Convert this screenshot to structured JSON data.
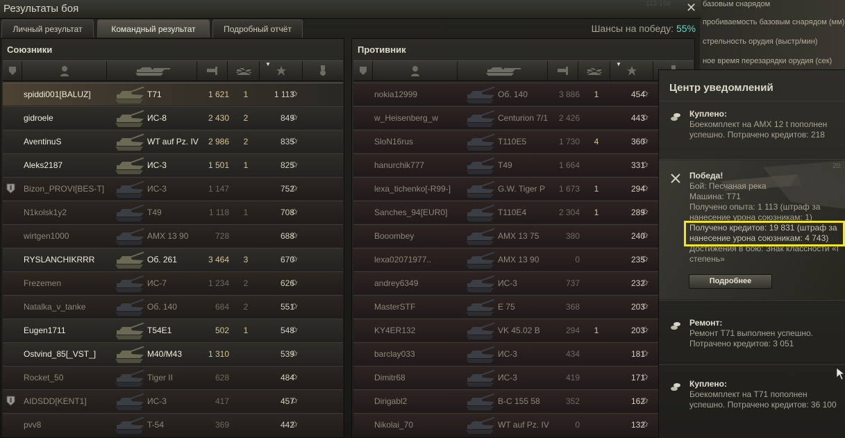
{
  "window": {
    "title": "Результаты боя",
    "ghost_text": "113-168"
  },
  "background_tooltip": {
    "lines": [
      "базовым снарядом",
      "пробиваемость базовым снарядом (мм)",
      "стрельность орудия (выстр/мин)",
      "ное время перезарядки орудия (сек)"
    ]
  },
  "tabs": [
    {
      "label": "Личный результат",
      "active": false
    },
    {
      "label": "Командный результат",
      "active": true
    },
    {
      "label": "Подробный отчёт",
      "active": false
    }
  ],
  "win_chance": {
    "label": "Шансы на победу:",
    "value": "55%"
  },
  "teams": {
    "allies": {
      "name": "Союзники",
      "players": [
        {
          "name": "spiddi001[BALUZ]",
          "vehicle": "T71",
          "damage": "1 621",
          "kills": "1",
          "xp": "1 113",
          "state": "self",
          "clan_icon": false
        },
        {
          "name": "gidroele",
          "vehicle": "ИС-8",
          "damage": "2 430",
          "kills": "2",
          "xp": "849",
          "state": "alive",
          "clan_icon": false
        },
        {
          "name": "AventinuS",
          "vehicle": "WT auf Pz. IV",
          "damage": "2 986",
          "kills": "2",
          "xp": "835",
          "state": "alive",
          "clan_icon": false
        },
        {
          "name": "Aleks2187",
          "vehicle": "ИС-3",
          "damage": "1 501",
          "kills": "1",
          "xp": "825",
          "state": "alive",
          "clan_icon": false
        },
        {
          "name": "Bizon_PROVI[BES-T]",
          "vehicle": "ИС-3",
          "damage": "1 147",
          "kills": "",
          "xp": "752",
          "state": "dead",
          "clan_icon": true
        },
        {
          "name": "N1kolsk1y2",
          "vehicle": "T49",
          "damage": "1 118",
          "kills": "1",
          "xp": "708",
          "state": "dead",
          "clan_icon": false
        },
        {
          "name": "wirtgen1000",
          "vehicle": "AMX 13 90",
          "damage": "728",
          "kills": "",
          "xp": "688",
          "state": "dead",
          "clan_icon": false
        },
        {
          "name": "RYSLANCHIKRRR",
          "vehicle": "Об. 261",
          "damage": "3 464",
          "kills": "3",
          "xp": "670",
          "state": "alive",
          "clan_icon": false
        },
        {
          "name": "Frezemen",
          "vehicle": "ИС-7",
          "damage": "1 234",
          "kills": "2",
          "xp": "626",
          "state": "dead",
          "clan_icon": false
        },
        {
          "name": "Natalka_v_tanke",
          "vehicle": "Об. 140",
          "damage": "684",
          "kills": "2",
          "xp": "551",
          "state": "dead",
          "clan_icon": false
        },
        {
          "name": "Eugen1711",
          "vehicle": "T54E1",
          "damage": "502",
          "kills": "1",
          "xp": "548",
          "state": "alive",
          "clan_icon": false
        },
        {
          "name": "Ostvind_85[_VST_]",
          "vehicle": "M40/M43",
          "damage": "1 310",
          "kills": "",
          "xp": "539",
          "state": "alive",
          "clan_icon": false
        },
        {
          "name": "Rocket_50",
          "vehicle": "Tiger II",
          "damage": "628",
          "kills": "",
          "xp": "484",
          "state": "dead",
          "clan_icon": false
        },
        {
          "name": "AIDSDD[KENT1]",
          "vehicle": "ИС-3",
          "damage": "417",
          "kills": "",
          "xp": "457",
          "state": "dead",
          "clan_icon": true
        },
        {
          "name": "pvv8",
          "vehicle": "T-54",
          "damage": "369",
          "kills": "",
          "xp": "442",
          "state": "dead",
          "clan_icon": false
        }
      ]
    },
    "enemies": {
      "name": "Противник",
      "players": [
        {
          "name": "nokia12999",
          "vehicle": "Об. 140",
          "damage": "3 886",
          "kills": "1",
          "xp": "454",
          "state": "dead"
        },
        {
          "name": "w_Heisenberg_w",
          "vehicle": "Centurion 7/1",
          "damage": "2 426",
          "kills": "",
          "xp": "443",
          "state": "dead"
        },
        {
          "name": "SloN16rus",
          "vehicle": "T110E5",
          "damage": "1 730",
          "kills": "4",
          "xp": "360",
          "state": "dead"
        },
        {
          "name": "hanurchik777",
          "vehicle": "T49",
          "damage": "1 664",
          "kills": "",
          "xp": "331",
          "state": "dead"
        },
        {
          "name": "lexa_tichenko[-R99-]",
          "vehicle": "G.W. Tiger P",
          "damage": "1 673",
          "kills": "1",
          "xp": "294",
          "state": "dead"
        },
        {
          "name": "Sanches_94[EUR0]",
          "vehicle": "T110E4",
          "damage": "2 304",
          "kills": "1",
          "xp": "289",
          "state": "dead"
        },
        {
          "name": "Booombey",
          "vehicle": "AMX 13 75",
          "damage": "380",
          "kills": "",
          "xp": "240",
          "state": "dead"
        },
        {
          "name": "lexa02071977..",
          "vehicle": "AMX 13 90",
          "damage": "0",
          "kills": "",
          "xp": "235",
          "state": "dead"
        },
        {
          "name": "andrey6349",
          "vehicle": "ИС-3",
          "damage": "737",
          "kills": "",
          "xp": "232",
          "state": "dead"
        },
        {
          "name": "MasterSTF",
          "vehicle": "E 75",
          "damage": "368",
          "kills": "",
          "xp": "203",
          "state": "dead"
        },
        {
          "name": "KY4ER132",
          "vehicle": "VK 45.02 B",
          "damage": "294",
          "kills": "1",
          "xp": "203",
          "state": "dead"
        },
        {
          "name": "barclay033",
          "vehicle": "ИС-3",
          "damage": "434",
          "kills": "",
          "xp": "181",
          "state": "dead"
        },
        {
          "name": "Dimitr68",
          "vehicle": "ИС-3",
          "damage": "419",
          "kills": "",
          "xp": "171",
          "state": "dead"
        },
        {
          "name": "Dirigabl2",
          "vehicle": "B-C 155 58",
          "damage": "352",
          "kills": "",
          "xp": "162",
          "state": "dead"
        },
        {
          "name": "Nikolai_70",
          "vehicle": "WT auf Pz. IV",
          "damage": "0",
          "kills": "",
          "xp": "132",
          "state": "dead"
        }
      ]
    }
  },
  "notifications": {
    "title": "Центр уведомлений",
    "items": [
      {
        "heading": "Куплено:",
        "lines": [
          "Боекомплект на AMX 12 t пополнен",
          "успешно. Потрачено кредитов:  218"
        ],
        "icon": "coins-icon"
      },
      {
        "heading": "Победа!",
        "time": "20:",
        "lines": [
          "Бой: Песчаная река",
          "Машина: T71",
          "Получено опыта: 1 113 (штраф за",
          "нанесение урона союзникам: 1)",
          "Получено кредитов: 19 831 (штраф за",
          "нанесение урона союзникам: 4 743)",
          "Достижения в бою: Знак классности «I",
          "степень»"
        ],
        "button": "Подробнее",
        "icon": "crossed-swords-icon"
      },
      {
        "heading": "Ремонт:",
        "lines": [
          "Ремонт T71 выполнен успешно.",
          "Потрачено кредитов:  3 051"
        ],
        "icon": "coins-icon"
      },
      {
        "heading": "Куплено:",
        "lines": [
          "Боекомплект на T71 пополнен",
          "успешно. Потрачено кредитов:  36 100"
        ],
        "icon": "coins-icon"
      }
    ]
  },
  "colors": {
    "win_chance": "#63d6c4",
    "highlight": "#f1e52b",
    "gold_numbers": "#d8c48e"
  }
}
